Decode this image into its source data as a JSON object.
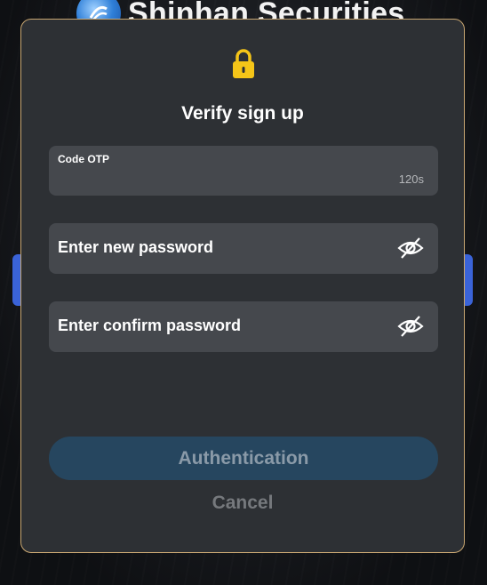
{
  "background": {
    "brand_name": "Shinhan Securities"
  },
  "dialog": {
    "title": "Verify sign up",
    "icon": "lock-icon",
    "otp": {
      "label": "Code OTP",
      "value": "",
      "timer": "120s"
    },
    "new_password": {
      "placeholder": "Enter new password",
      "icon": "eye-slash-icon"
    },
    "confirm_password": {
      "placeholder": "Enter confirm password",
      "icon": "eye-slash-icon"
    },
    "authentication_label": "Authentication",
    "cancel_label": "Cancel"
  },
  "colors": {
    "dialog_bg": "#2d3034",
    "dialog_border": "#c9a772",
    "field_bg": "#45484d",
    "lock_yellow": "#f5c518",
    "auth_button_bg": "#26465f",
    "side_button_blue": "#3a63d8"
  }
}
